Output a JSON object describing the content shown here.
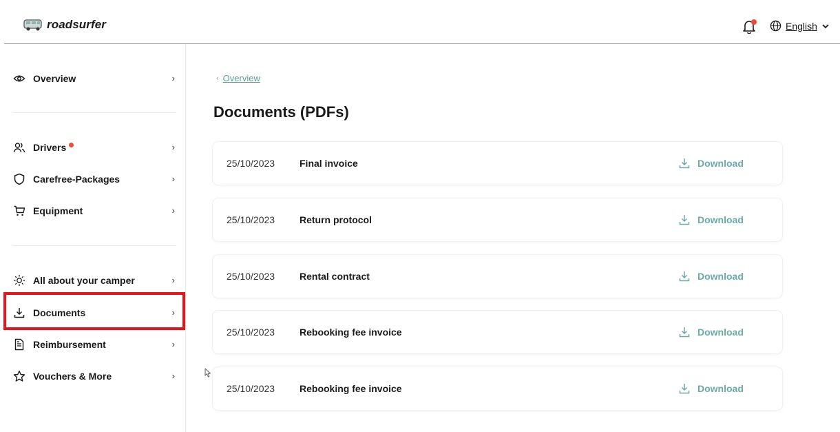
{
  "header": {
    "brand": "roadsurfer",
    "language": "English"
  },
  "sidebar": {
    "items": [
      {
        "label": "Overview",
        "icon": "eye-icon"
      },
      {
        "label": "Drivers",
        "icon": "users-icon",
        "badge": true
      },
      {
        "label": "Carefree-Packages",
        "icon": "shield-icon"
      },
      {
        "label": "Equipment",
        "icon": "cart-icon"
      },
      {
        "label": "All about your camper",
        "icon": "bulb-icon"
      },
      {
        "label": "Documents",
        "icon": "download-icon",
        "selected": true
      },
      {
        "label": "Reimbursement",
        "icon": "file-text-icon"
      },
      {
        "label": "Vouchers & More",
        "icon": "star-icon"
      }
    ]
  },
  "main": {
    "breadcrumb": "Overview",
    "title": "Documents (PDFs)",
    "download_label": "Download",
    "documents": [
      {
        "date": "25/10/2023",
        "name": "Final invoice"
      },
      {
        "date": "25/10/2023",
        "name": "Return protocol"
      },
      {
        "date": "25/10/2023",
        "name": "Rental contract"
      },
      {
        "date": "25/10/2023",
        "name": "Rebooking fee invoice"
      },
      {
        "date": "25/10/2023",
        "name": "Rebooking fee invoice"
      }
    ]
  },
  "colors": {
    "accent": "#6aaaa6",
    "notification": "#ef4b3a",
    "highlight": "#e8141b"
  }
}
